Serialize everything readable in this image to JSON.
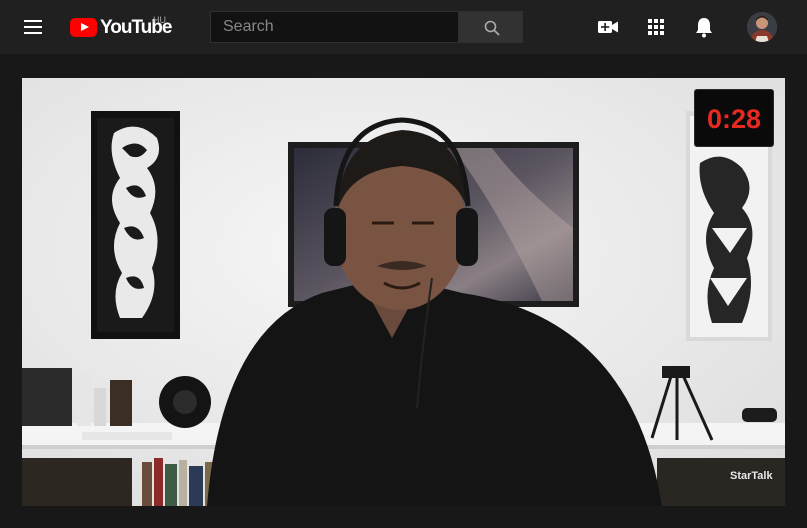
{
  "app": {
    "logo_text": "YouTube",
    "region": "HU"
  },
  "search": {
    "placeholder": "Search",
    "value": ""
  },
  "header_icons": [
    "menu-icon",
    "create-video-icon",
    "apps-icon",
    "notifications-icon"
  ],
  "video": {
    "timer": "0:28",
    "watermark": "StarTalk"
  },
  "colors": {
    "brand": "#ff0000",
    "topbar": "#202020",
    "background": "#181818",
    "timer_text": "#e52a22"
  }
}
